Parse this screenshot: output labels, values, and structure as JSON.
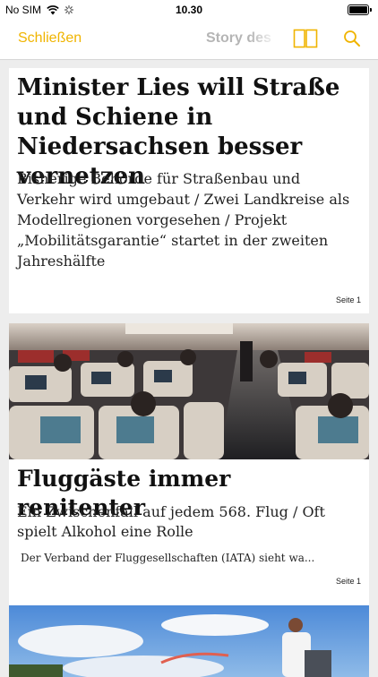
{
  "status": {
    "carrier": "No SIM",
    "time": "10.30",
    "battery_level": 1.0
  },
  "nav": {
    "close_label": "Schließen",
    "title": "Story des",
    "icons": [
      "pages-icon",
      "search-icon"
    ],
    "accent_color": "#f0b400"
  },
  "articles": [
    {
      "headline": "Minister Lies will Straße und Schiene in Niedersachsen besser vernetzen",
      "subline": "Bisherige Behörde für Straßenbau und Verkehr wird umgebaut / Zwei Landkreise als Modellregionen vorgesehen / Projekt „Mobilitätsgarantie“ startet in der zweiten Jahreshälfte",
      "page": "Seite 1"
    },
    {
      "headline": "Fluggäste immer renitenter",
      "subline": "Ein Zwischenfall auf jedem 568. Flug / Oft spielt Alkohol eine Rolle",
      "teaser": "Der Verband der Fluggesellschaften (IATA) sieht wa...",
      "page": "Seite 1"
    }
  ]
}
